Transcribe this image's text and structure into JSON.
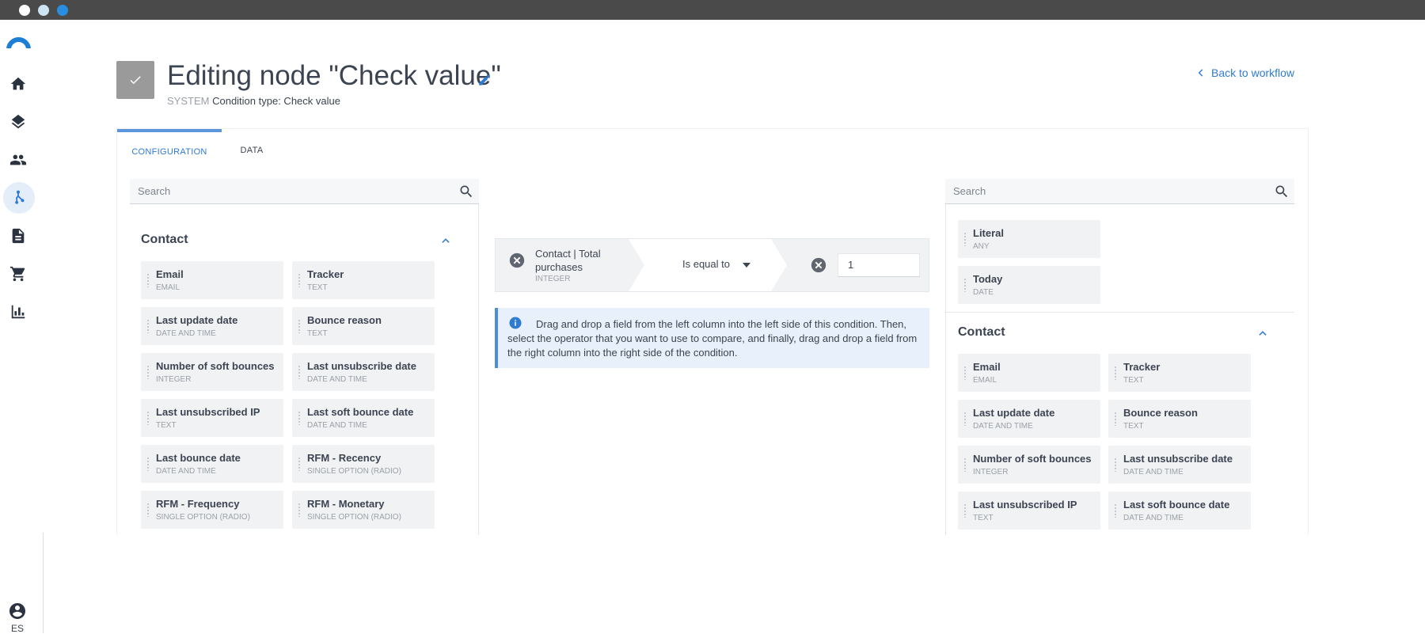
{
  "app": {
    "language": "ES"
  },
  "header": {
    "title": "Editing node \"Check value\"",
    "system_label": "SYSTEM",
    "condition_type": "Condition type: Check value",
    "back_label": "Back to workflow"
  },
  "tabs": [
    {
      "label": "CONFIGURATION",
      "active": true
    },
    {
      "label": "DATA",
      "active": false
    }
  ],
  "left_panel": {
    "search_placeholder": "Search",
    "section_title": "Contact",
    "fields": [
      {
        "name": "Email",
        "type": "EMAIL"
      },
      {
        "name": "Tracker",
        "type": "TEXT"
      },
      {
        "name": "Last update date",
        "type": "DATE AND TIME"
      },
      {
        "name": "Bounce reason",
        "type": "TEXT"
      },
      {
        "name": "Number of soft bounces",
        "type": "INTEGER"
      },
      {
        "name": "Last unsubscribe date",
        "type": "DATE AND TIME"
      },
      {
        "name": "Last unsubscribed IP",
        "type": "TEXT"
      },
      {
        "name": "Last soft bounce date",
        "type": "DATE AND TIME"
      },
      {
        "name": "Last bounce date",
        "type": "DATE AND TIME"
      },
      {
        "name": "RFM - Recency",
        "type": "SINGLE OPTION (RADIO)"
      },
      {
        "name": "RFM - Frequency",
        "type": "SINGLE OPTION (RADIO)"
      },
      {
        "name": "RFM - Monetary",
        "type": "SINGLE OPTION (RADIO)"
      }
    ]
  },
  "condition": {
    "left_field": "Contact | Total purchases",
    "left_type": "INTEGER",
    "operator": "Is equal to",
    "right_value": "1"
  },
  "info_text": "Drag and drop a field from the left column into the left side of this condition. Then, select the operator that you want to use to compare, and finally, drag and drop a field from the right column into the right side of the condition.",
  "right_panel": {
    "search_placeholder": "Search",
    "special_fields": [
      {
        "name": "Literal",
        "type": "ANY"
      },
      {
        "name": "Today",
        "type": "DATE"
      }
    ],
    "section_title": "Contact",
    "fields": [
      {
        "name": "Email",
        "type": "EMAIL"
      },
      {
        "name": "Tracker",
        "type": "TEXT"
      },
      {
        "name": "Last update date",
        "type": "DATE AND TIME"
      },
      {
        "name": "Bounce reason",
        "type": "TEXT"
      },
      {
        "name": "Number of soft bounces",
        "type": "INTEGER"
      },
      {
        "name": "Last unsubscribe date",
        "type": "DATE AND TIME"
      },
      {
        "name": "Last unsubscribed IP",
        "type": "TEXT"
      },
      {
        "name": "Last soft bounce date",
        "type": "DATE AND TIME"
      }
    ]
  },
  "colors": {
    "accent": "#2f7bd1",
    "nav_icon": "#2b3340",
    "field_bg": "#f1f2f4"
  },
  "icons": [
    "home-icon",
    "layers-icon",
    "people-icon",
    "workflow-icon",
    "document-icon",
    "cart-icon",
    "chart-icon",
    "user-icon",
    "check-icon",
    "pencil-icon",
    "chevron-left-icon",
    "search-icon",
    "chevron-up-icon",
    "clear-icon",
    "caret-down-icon",
    "info-icon"
  ]
}
